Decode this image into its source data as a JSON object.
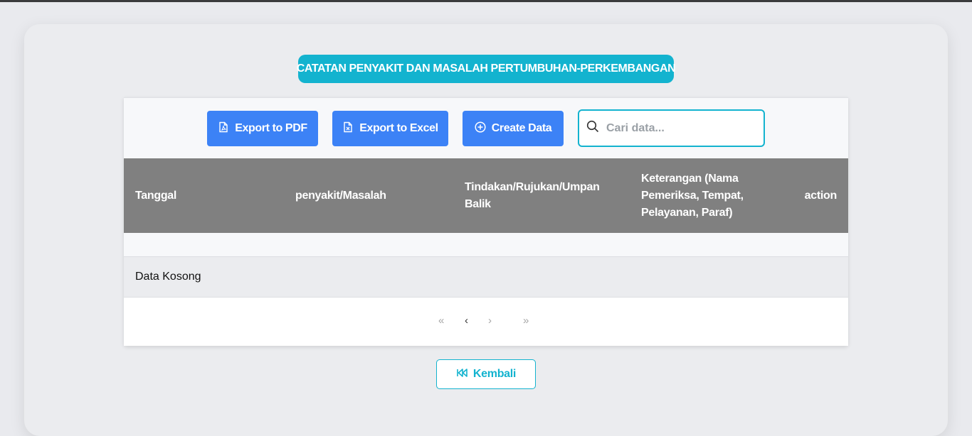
{
  "page": {
    "title": "CATATAN PENYAKIT DAN MASALAH PERTUMBUHAN-PERKEMBANGAN"
  },
  "toolbar": {
    "export_pdf_label": "Export to PDF",
    "export_excel_label": "Export to Excel",
    "create_label": "Create Data",
    "search_placeholder": "Cari data..."
  },
  "table": {
    "columns": [
      "Tanggal",
      "penyakit/Masalah",
      "Tindakan/Rujukan/Umpan Balik",
      "Keterangan (Nama Pemeriksa, Tempat, Pelayanan, Paraf)",
      "action"
    ],
    "empty_text": "Data Kosong"
  },
  "pagination": {
    "first": "«",
    "prev": "‹",
    "next": "›",
    "last": "»"
  },
  "back": {
    "label": "Kembali"
  },
  "colors": {
    "accent": "#13b3cf",
    "primary_button": "#3c82f6",
    "header_bg": "#808080"
  },
  "icons": {
    "pdf": "file-pdf-icon",
    "excel": "file-excel-icon",
    "create": "plus-circle-icon",
    "search": "search-icon",
    "back": "rewind-icon"
  }
}
